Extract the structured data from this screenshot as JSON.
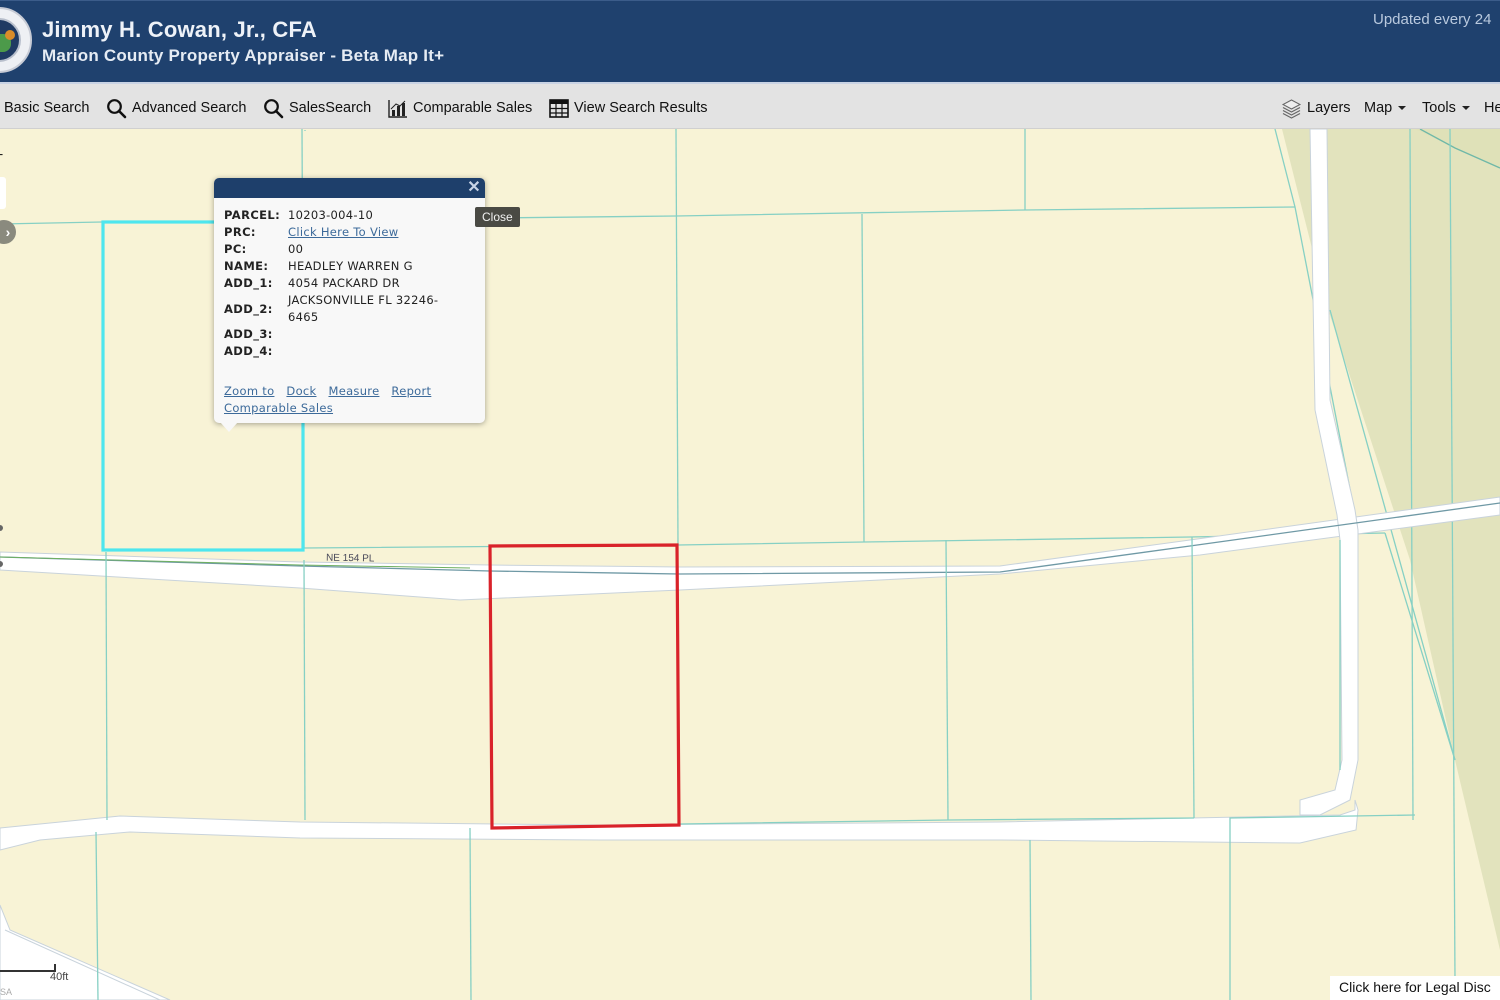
{
  "header": {
    "title": "Jimmy H. Cowan, Jr., CFA",
    "subtitle": "Marion County Property Appraiser - Beta Map It+",
    "updated_notice": "Updated every 24",
    "logo": "county-seal-logo"
  },
  "toolbar": {
    "left": [
      {
        "label": "Basic Search",
        "icon": "none"
      },
      {
        "label": "Advanced Search",
        "icon": "search-icon"
      },
      {
        "label": "SalesSearch",
        "icon": "search-icon"
      },
      {
        "label": "Comparable Sales",
        "icon": "bar-chart-icon"
      },
      {
        "label": "View Search Results",
        "icon": "table-grid-icon"
      }
    ],
    "right": [
      {
        "label": "Layers",
        "icon": "layers-icon",
        "dropdown": false
      },
      {
        "label": "Map",
        "dropdown": true
      },
      {
        "label": "Tools",
        "dropdown": true
      },
      {
        "label": "He",
        "dropdown": false
      }
    ]
  },
  "map": {
    "road_label": "NE 154 PL",
    "colors": {
      "parcel_fill": "#f8f3d6",
      "green_area": "#e2e3bd",
      "parcel_line": "#86d0c4",
      "road": "#ffffff",
      "selected_parcel": "#d9222a",
      "highlighted_parcel": "#4ee6ee"
    },
    "controls": {
      "zoom_in": "+",
      "nav_arrow": "›"
    },
    "scale_bar_label": "40ft",
    "attribution": "SA",
    "legal_link": "Click here for Legal Disc"
  },
  "popup": {
    "close_glyph": "✕",
    "tooltip": "Close",
    "fields": [
      {
        "key": "PARCEL:",
        "value": "10203-004-10"
      },
      {
        "key": "PRC:",
        "value": "Click Here To View",
        "link": true
      },
      {
        "key": "PC:",
        "value": "00"
      },
      {
        "key": "NAME:",
        "value": "HEADLEY WARREN G"
      },
      {
        "key": "ADD_1:",
        "value": "4054 PACKARD DR"
      },
      {
        "key": "ADD_2:",
        "value": "JACKSONVILLE FL 32246-6465"
      },
      {
        "key": "ADD_3:",
        "value": ""
      },
      {
        "key": "ADD_4:",
        "value": ""
      }
    ],
    "links": [
      "Zoom to",
      "Dock",
      "Measure",
      "Report",
      "Comparable Sales"
    ]
  }
}
